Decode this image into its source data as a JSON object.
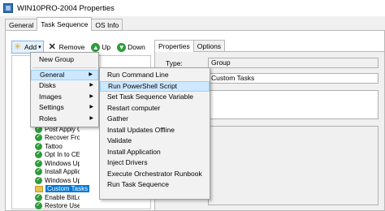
{
  "window": {
    "title": "WIN10PRO-2004 Properties"
  },
  "tabs": [
    {
      "label": "General"
    },
    {
      "label": "Task Sequence"
    },
    {
      "label": "OS Info"
    }
  ],
  "toolbar": {
    "add": "Add",
    "remove": "Remove",
    "up": "Up",
    "down": "Down"
  },
  "tree": {
    "items": [
      {
        "label": "Post Apply Cleanup",
        "icon": "check"
      },
      {
        "label": "Recover From Domain",
        "icon": "check"
      },
      {
        "label": "Tattoo",
        "icon": "check"
      },
      {
        "label": "Opt In to CEIP and WER",
        "icon": "check"
      },
      {
        "label": "Windows Update (Pre-Application Installation)",
        "icon": "check"
      },
      {
        "label": "Install Applications",
        "icon": "check"
      },
      {
        "label": "Windows Update (Post-Application Installation)",
        "icon": "check"
      },
      {
        "label": "Custom Tasks",
        "icon": "folder",
        "selected": true
      },
      {
        "label": "Enable BitLocker",
        "icon": "check"
      },
      {
        "label": "Restore User State",
        "icon": "check"
      }
    ]
  },
  "right": {
    "tabs": [
      {
        "label": "Properties"
      },
      {
        "label": "Options"
      }
    ],
    "type_label": "Type:",
    "type_value": "Group",
    "name_value": "Custom Tasks"
  },
  "add_menu": {
    "items": [
      {
        "label": "New Group"
      },
      {
        "label": "General",
        "submenu": true
      },
      {
        "label": "Disks",
        "submenu": true
      },
      {
        "label": "Images",
        "submenu": true
      },
      {
        "label": "Settings",
        "submenu": true
      },
      {
        "label": "Roles",
        "submenu": true
      }
    ]
  },
  "general_submenu": {
    "items": [
      {
        "label": "Run Command Line"
      },
      {
        "label": "Run PowerShell Script"
      },
      {
        "label": "Set Task Sequence Variable"
      },
      {
        "label": "Restart computer"
      },
      {
        "label": "Gather"
      },
      {
        "label": "Install Updates Offline"
      },
      {
        "label": "Validate"
      },
      {
        "label": "Install Application"
      },
      {
        "label": "Inject Drivers"
      },
      {
        "label": "Execute Orchestrator Runbook"
      },
      {
        "label": "Run Task Sequence"
      }
    ]
  }
}
